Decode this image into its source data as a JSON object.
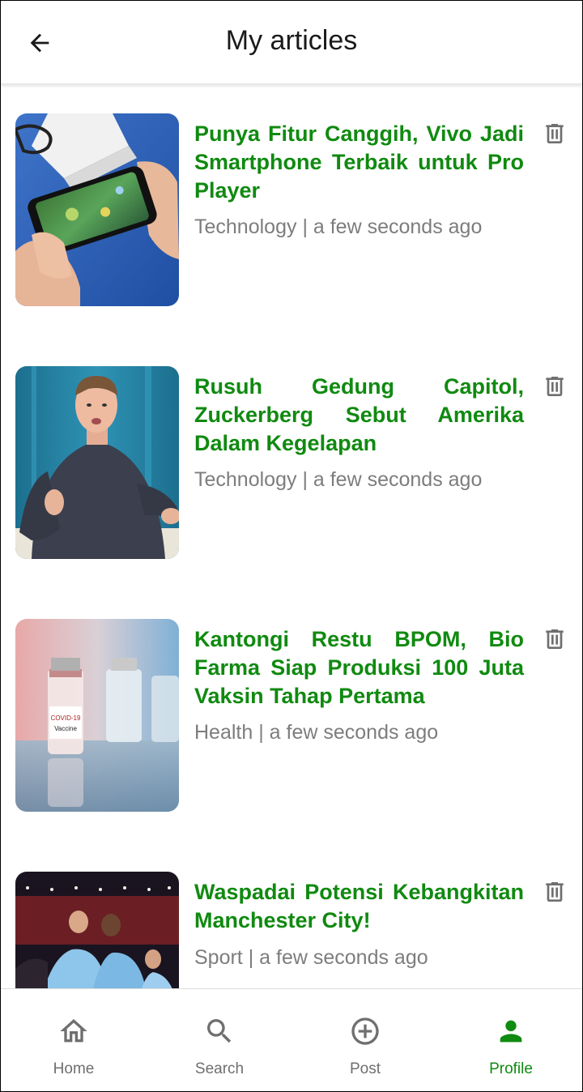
{
  "header": {
    "title": "My articles",
    "back_icon": "arrow-left-icon"
  },
  "articles": [
    {
      "title": "Punya Fitur Canggih, Vivo Jadi Smartphone Terbaik untuk Pro Player",
      "category": "Technology",
      "separator": "|",
      "time": "a few seconds ago",
      "thumbnail": "hands-holding-smartphone-gaming",
      "action_icon": "trash-icon"
    },
    {
      "title": "Rusuh Gedung Capitol, Zuckerberg Sebut Amerika Dalam Kegelapan",
      "category": "Technology",
      "separator": "|",
      "time": "a few seconds ago",
      "thumbnail": "man-speaking-on-stage",
      "action_icon": "trash-icon"
    },
    {
      "title": "Kantongi Restu BPOM, Bio Farma Siap Produksi 100 Juta Vaksin Tahap Pertama",
      "category": "Health",
      "separator": "|",
      "time": "a few seconds ago",
      "thumbnail": "vaccine-vials",
      "thumbnail_labels": [
        "COVID-19",
        "Vaccine"
      ],
      "action_icon": "trash-icon"
    },
    {
      "title": "Waspadai Potensi Kebangkitan Manchester City!",
      "category": "Sport",
      "separator": "|",
      "time": "a few seconds ago",
      "thumbnail": "football-players-celebrating",
      "action_icon": "trash-icon"
    }
  ],
  "bottom_nav": [
    {
      "label": "Home",
      "icon": "home-icon",
      "active": false
    },
    {
      "label": "Search",
      "icon": "search-icon",
      "active": false
    },
    {
      "label": "Post",
      "icon": "plus-circle-icon",
      "active": false
    },
    {
      "label": "Profile",
      "icon": "person-icon",
      "active": true
    }
  ],
  "colors": {
    "accent": "#108a10",
    "meta_text": "#7d7d7d",
    "icon_gray": "#6f6f6f",
    "title_text": "#1a1a1a"
  }
}
